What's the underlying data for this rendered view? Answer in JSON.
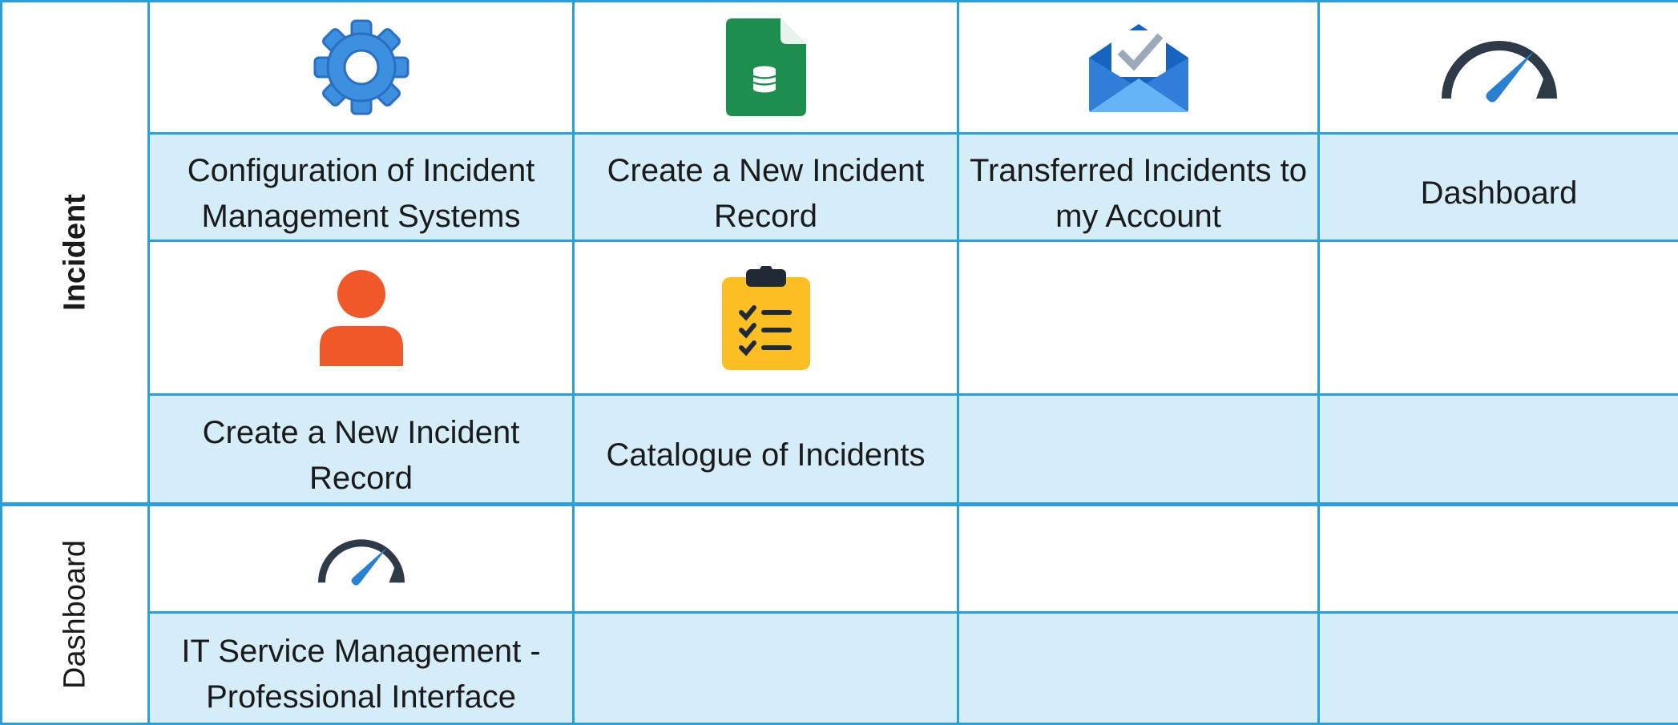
{
  "sections": {
    "incident": {
      "label": "Incident"
    },
    "dashboard": {
      "label": "Dashboard"
    }
  },
  "tiles": {
    "config_systems": {
      "label": "Configuration of Incident Management Systems",
      "icon": "gear-icon",
      "color": "#3d8fe0"
    },
    "create_record_1": {
      "label": "Create a New Incident Record",
      "icon": "spreadsheet-file-icon",
      "color": "#1e8e4e"
    },
    "transferred": {
      "label": "Transferred Incidents to  my Account",
      "icon": "mail-check-icon",
      "color": "#2f7fd8"
    },
    "dashboard_tile": {
      "label": "Dashboard",
      "icon": "speedometer-icon",
      "color": "#2b7fd0"
    },
    "create_record_2": {
      "label": "Create a New Incident Record",
      "icon": "user-icon",
      "color": "#f0582a"
    },
    "catalogue": {
      "label": "Catalogue of Incidents",
      "icon": "clipboard-checklist-icon",
      "color": "#fbbf24"
    },
    "itsm_pro": {
      "label": "IT Service Management - Professional Interface",
      "icon": "speedometer-icon",
      "color": "#2b7fd0"
    }
  },
  "colors": {
    "grid_line": "#2b9fd9",
    "label_background": "#d4edf8"
  }
}
